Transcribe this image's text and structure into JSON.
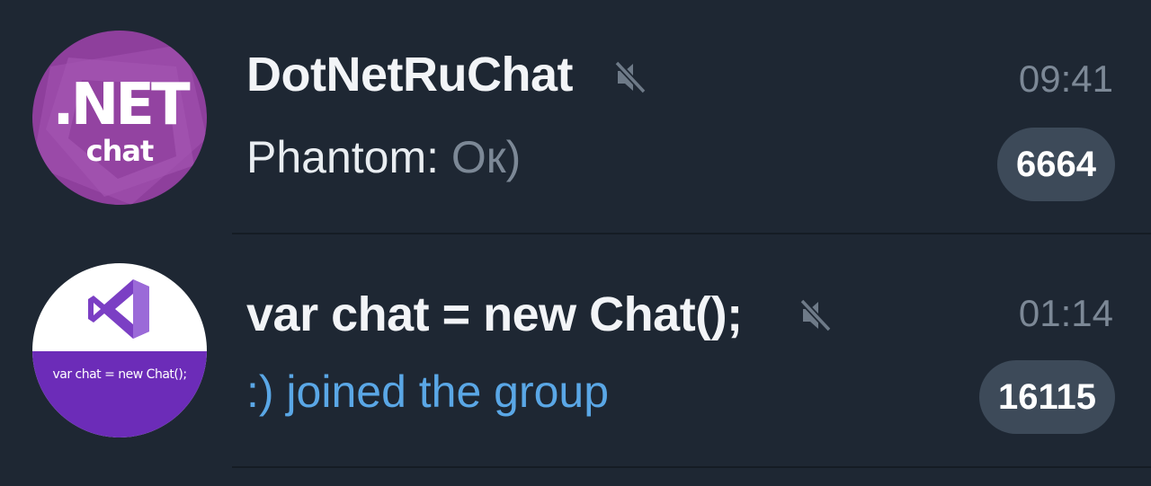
{
  "chats": [
    {
      "avatar": {
        "line1": ".NET",
        "line2": "chat",
        "color": "#8e3f9c"
      },
      "title": "DotNetRuChat",
      "muted_icon": "mute-speaker-icon",
      "time": "09:41",
      "preview_sender": "Phantom: ",
      "preview_text": "Ок)",
      "unread_count": "6664"
    },
    {
      "avatar": {
        "caption": "var chat = new Chat();",
        "band_color": "#6c2cb8",
        "logo": "visual-studio-logo"
      },
      "title": "var chat = new Chat();",
      "muted_icon": "mute-speaker-icon",
      "time": "01:14",
      "preview_text": ":) joined the group",
      "unread_count": "16115"
    }
  ],
  "colors": {
    "background": "#1e2733",
    "badge": "#3d4a59",
    "service_text": "#5aa7e6",
    "secondary_text": "#7c8896"
  }
}
